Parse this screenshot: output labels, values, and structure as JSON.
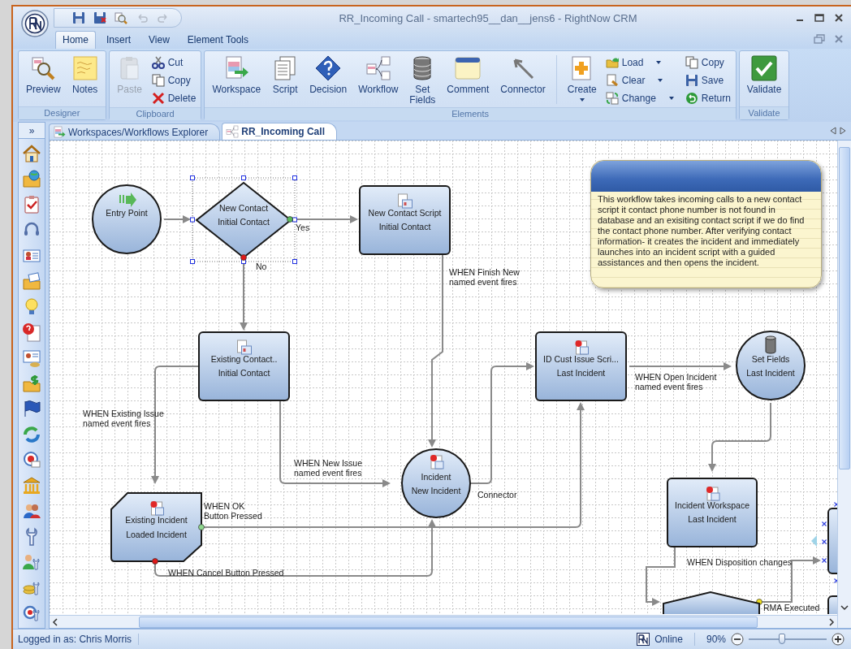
{
  "window": {
    "title": "RR_Incoming  Call - smartech95__dan__jens6  - RightNow CRM"
  },
  "ribbon_tabs": [
    {
      "label": "Home",
      "selected": true
    },
    {
      "label": "Insert",
      "selected": false
    },
    {
      "label": "View",
      "selected": false
    },
    {
      "label": "Element Tools",
      "selected": false
    }
  ],
  "ribbon_groups": [
    {
      "title": "Designer",
      "items": [
        {
          "kind": "large",
          "label": "Preview",
          "disabled": false,
          "dropdown": false
        },
        {
          "kind": "large",
          "label": "Notes",
          "disabled": false,
          "dropdown": false
        }
      ]
    },
    {
      "title": "Clipboard",
      "items": [
        {
          "kind": "large",
          "label": "Paste",
          "disabled": true,
          "dropdown": false
        },
        {
          "kind": "small",
          "label": "Cut",
          "disabled": false,
          "dropdown": false
        },
        {
          "kind": "small",
          "label": "Copy",
          "disabled": false,
          "dropdown": false
        },
        {
          "kind": "small",
          "label": "Delete",
          "disabled": false,
          "dropdown": false
        }
      ]
    },
    {
      "title": "Elements",
      "items": [
        {
          "kind": "large",
          "label": "Workspace",
          "disabled": false,
          "dropdown": false
        },
        {
          "kind": "large",
          "label": "Script",
          "disabled": false,
          "dropdown": false
        },
        {
          "kind": "large",
          "label": "Decision",
          "disabled": false,
          "dropdown": false
        },
        {
          "kind": "large",
          "label": "Workflow",
          "disabled": false,
          "dropdown": false
        },
        {
          "kind": "large",
          "label": "Set Fields",
          "disabled": false,
          "dropdown": false
        },
        {
          "kind": "large",
          "label": "Comment",
          "disabled": false,
          "dropdown": false
        },
        {
          "kind": "large",
          "label": "Connector",
          "disabled": false,
          "dropdown": false
        },
        {
          "kind": "large",
          "label": "Create",
          "disabled": false,
          "dropdown": true
        },
        {
          "kind": "small",
          "label": "Load",
          "disabled": false,
          "dropdown": true
        },
        {
          "kind": "small",
          "label": "Clear",
          "disabled": false,
          "dropdown": true
        },
        {
          "kind": "small",
          "label": "Change",
          "disabled": false,
          "dropdown": true
        },
        {
          "kind": "small",
          "label": "Copy",
          "disabled": false,
          "dropdown": false
        },
        {
          "kind": "small",
          "label": "Save",
          "disabled": false,
          "dropdown": false
        },
        {
          "kind": "small",
          "label": "Return",
          "disabled": false,
          "dropdown": false
        }
      ]
    },
    {
      "title": "Validate",
      "items": [
        {
          "kind": "large",
          "label": "Validate",
          "disabled": false,
          "dropdown": false
        }
      ]
    }
  ],
  "document_tabs": [
    {
      "label": "Workspaces/Workflows Explorer",
      "selected": false
    },
    {
      "label": "RR_Incoming Call",
      "selected": true
    }
  ],
  "sidebar": {
    "toggle": "»"
  },
  "diagram": {
    "nodes": [
      {
        "kind": "circle",
        "title": "Entry Point",
        "selected": false
      },
      {
        "kind": "diamond",
        "title": "New Contact",
        "subtitle": "Initial Contact",
        "selected": true
      },
      {
        "kind": "box",
        "title": "New Contact Script",
        "subtitle": "Initial Contact",
        "selected": false
      },
      {
        "kind": "box",
        "title": "Existing Contact..",
        "subtitle": "Initial Contact",
        "selected": false
      },
      {
        "kind": "box",
        "title": "ID Cust Issue Scri...",
        "subtitle": "Last Incident",
        "selected": false
      },
      {
        "kind": "circle",
        "title": "Set Fields",
        "subtitle": "Last Incident",
        "selected": false
      },
      {
        "kind": "circle",
        "title": "Incident",
        "subtitle": "New Incident",
        "selected": false
      },
      {
        "kind": "octagon",
        "title": "Existing Incident",
        "subtitle": "Loaded Incident",
        "selected": false
      },
      {
        "kind": "box",
        "title": "Incident Workspace",
        "subtitle": "Last Incident",
        "selected": false
      }
    ],
    "connector_labels": [
      {
        "lines": [
          "Yes"
        ]
      },
      {
        "lines": [
          "No"
        ]
      },
      {
        "lines": [
          "WHEN Finish New",
          "named event fires"
        ]
      },
      {
        "lines": [
          "WHEN Existing Issue",
          "named event fires"
        ]
      },
      {
        "lines": [
          "WHEN New Issue",
          "named event fires"
        ]
      },
      {
        "lines": [
          "Connector"
        ]
      },
      {
        "lines": [
          "WHEN OK",
          "Button Pressed"
        ]
      },
      {
        "lines": [
          "WHEN Cancel Button Pressed"
        ]
      },
      {
        "lines": [
          "WHEN Open Incident",
          "named event fires"
        ]
      },
      {
        "lines": [
          "WHEN Disposition changes"
        ]
      },
      {
        "lines": [
          "RMA Executed"
        ]
      }
    ],
    "comment": {
      "text": "This workflow takes incoming calls to a new contact script it contact phone number is not found in database and an exisiting contact script if we do find the contact phone number.  After verifying contact information- it creates the incident and immediately launches into an incident script with a guided assistances and then opens the incident."
    }
  },
  "status_bar": {
    "user": "Logged in as: Chris Morris",
    "connection": "Online",
    "zoom": "90%",
    "zoom_slider": {
      "level": 0.43
    }
  }
}
